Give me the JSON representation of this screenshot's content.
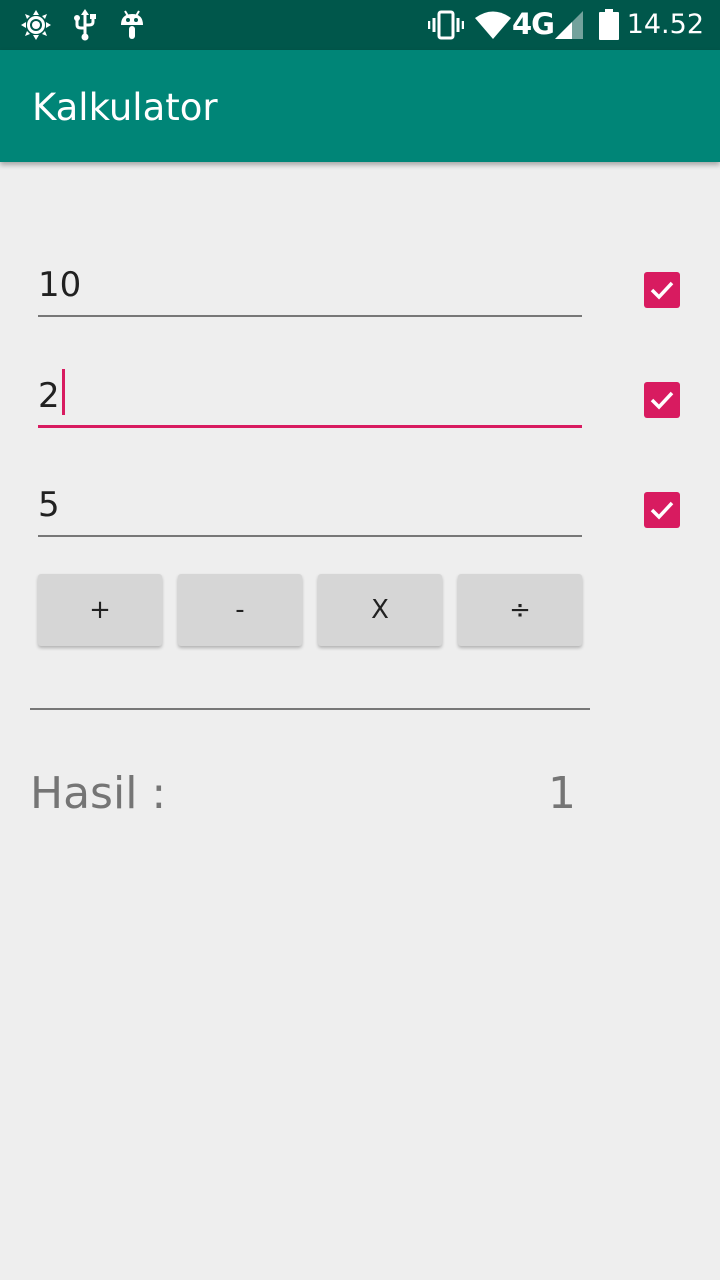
{
  "status_bar": {
    "time": "14.52",
    "network": "4G",
    "icons": [
      "brightness-icon",
      "usb-icon",
      "android-debug-icon",
      "vibrate-icon",
      "wifi-icon",
      "signal-icon",
      "battery-icon"
    ]
  },
  "app_bar": {
    "title": "Kalkulator"
  },
  "inputs": [
    {
      "value": "10",
      "checked": true
    },
    {
      "value": "2",
      "checked": true,
      "focused": true
    },
    {
      "value": "5",
      "checked": true
    }
  ],
  "operations": [
    "+",
    "-",
    "X",
    "÷"
  ],
  "result": {
    "label": "Hasil :",
    "value": "1"
  },
  "colors": {
    "primary": "#008577",
    "primary_dark": "#00574b",
    "accent": "#d81b60",
    "background": "#eeeeee"
  }
}
